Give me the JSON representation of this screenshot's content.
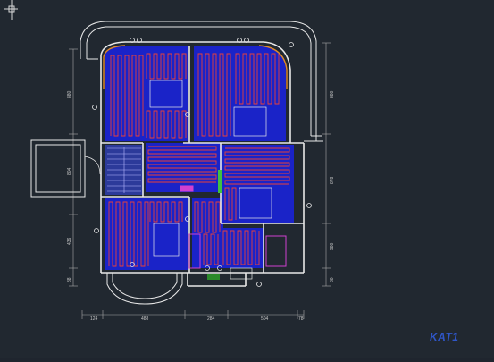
{
  "drawing": {
    "title_stamp": "KAT1",
    "dims_bottom": [
      "124",
      "488",
      "284",
      "504",
      "78"
    ],
    "dims_left": [
      "880",
      "804",
      "436",
      "88"
    ],
    "dims_right": [
      "880",
      "878",
      "980",
      "80"
    ]
  },
  "colors": {
    "background": "#212830",
    "wall": "#e8e8e8",
    "heating_pipe": "#e8403a",
    "room_fill": "#1a23c8",
    "balcony_edge": "#e08a2a",
    "stairs_fill": "#2c3a9a",
    "manifold": "#d040d0",
    "valve": "#40c040",
    "dimension": "#c8c8c8"
  }
}
